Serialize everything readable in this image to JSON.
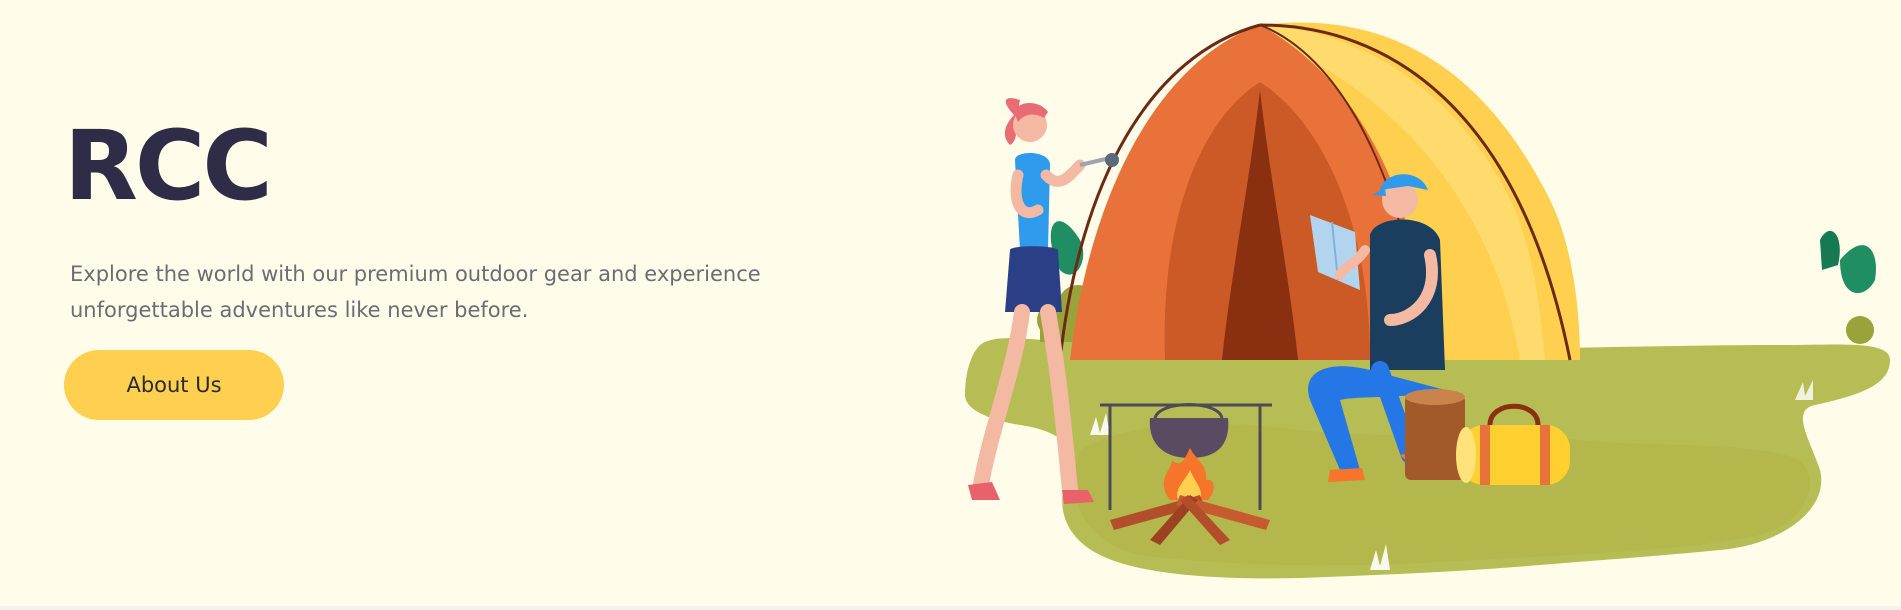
{
  "hero": {
    "title": "RCC",
    "description": "Explore the world with our premium outdoor gear and experience unforgettable adventures like never before.",
    "cta_label": "About Us"
  },
  "colors": {
    "background": "#fffde9",
    "title": "#2e2c47",
    "text": "#6e6b73",
    "button": "#ffd04f",
    "tent_orange": "#e8723a",
    "tent_yellow": "#ffd04f",
    "grass": "#b8bd4e"
  },
  "illustration": {
    "subject": "camping scene",
    "elements": [
      "tent-icon",
      "hiker-woman-icon",
      "camper-man-with-map-icon",
      "campfire-pot-icon",
      "duffel-bag-icon",
      "bushes-icon"
    ]
  }
}
